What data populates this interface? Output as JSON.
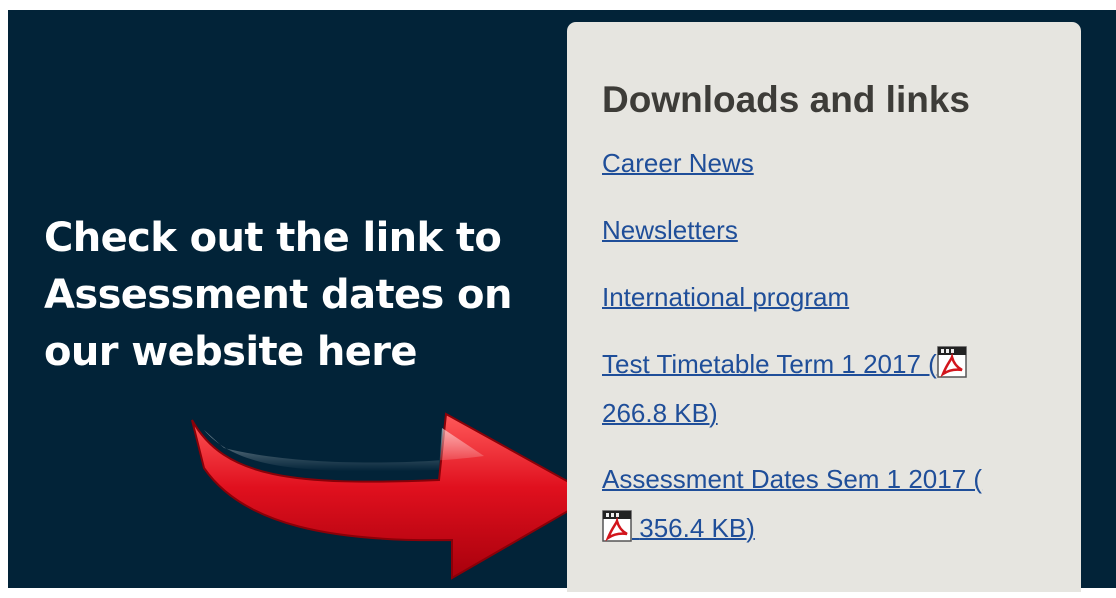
{
  "callout": {
    "lines": [
      "Check out the link to",
      "Assessment dates on",
      "our website here"
    ]
  },
  "panel": {
    "title": "Downloads and links",
    "links": [
      {
        "label": "Career News"
      },
      {
        "label": "Newsletters"
      },
      {
        "label": "International program"
      },
      {
        "label_before_icon": "Test Timetable Term 1 2017 (",
        "label_after_icon": "266.8 KB)"
      },
      {
        "label_before_icon": "Assessment Dates Sem 1 2017 (",
        "label_after_icon": "356.4 KB)"
      }
    ]
  },
  "colors": {
    "background": "#022338",
    "panel": "#e6e5e0",
    "link": "#1f4e99",
    "title": "#3d3c38",
    "arrow": "#e0101e"
  },
  "icons": {
    "pdf": "pdf-file-icon",
    "arrow": "red-arrow-pointer"
  }
}
